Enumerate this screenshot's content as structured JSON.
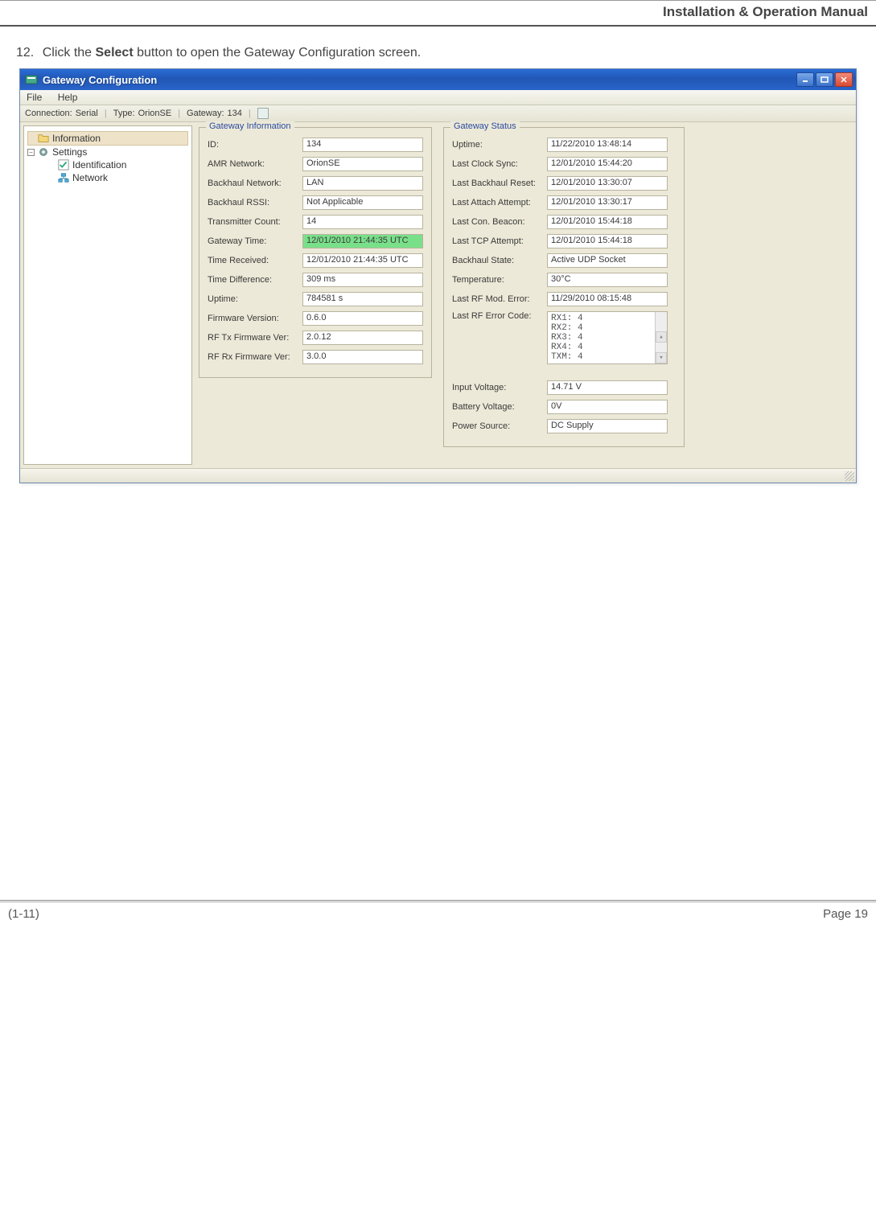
{
  "header": {
    "title": "Installation & Operation Manual"
  },
  "instruction": {
    "number": "12.",
    "prefix": "Click the ",
    "bold": "Select",
    "suffix": " button to open the Gateway Configuration screen."
  },
  "window": {
    "title": "Gateway Configuration",
    "menu": {
      "file": "File",
      "help": "Help"
    },
    "toolbar": {
      "connection_label": "Connection:",
      "connection_value": "Serial",
      "type_label": "Type:",
      "type_value": "OrionSE",
      "gateway_label": "Gateway:",
      "gateway_value": "134"
    },
    "tree": {
      "information": "Information",
      "settings": "Settings",
      "identification": "Identification",
      "network": "Network"
    }
  },
  "gateway_info": {
    "legend": "Gateway Information",
    "rows": {
      "id": {
        "label": "ID:",
        "value": "134"
      },
      "amr": {
        "label": "AMR Network:",
        "value": "OrionSE"
      },
      "backhaul_net": {
        "label": "Backhaul Network:",
        "value": "LAN"
      },
      "backhaul_rssi": {
        "label": "Backhaul RSSI:",
        "value": "Not Applicable"
      },
      "tx_count": {
        "label": "Transmitter Count:",
        "value": "14"
      },
      "gw_time": {
        "label": "Gateway Time:",
        "value": "12/01/2010 21:44:35 UTC"
      },
      "time_recv": {
        "label": "Time Received:",
        "value": "12/01/2010 21:44:35 UTC"
      },
      "time_diff": {
        "label": "Time Difference:",
        "value": "309 ms"
      },
      "uptime": {
        "label": "Uptime:",
        "value": "784581 s"
      },
      "fw": {
        "label": "Firmware Version:",
        "value": "0.6.0"
      },
      "rftx": {
        "label": "RF Tx Firmware Ver:",
        "value": "2.0.12"
      },
      "rfrx": {
        "label": "RF Rx Firmware Ver:",
        "value": "3.0.0"
      }
    }
  },
  "gateway_status": {
    "legend": "Gateway Status",
    "rows": {
      "uptime": {
        "label": "Uptime:",
        "value": "11/22/2010 13:48:14"
      },
      "last_clock": {
        "label": "Last Clock Sync:",
        "value": "12/01/2010 15:44:20"
      },
      "last_bh_reset": {
        "label": "Last Backhaul Reset:",
        "value": "12/01/2010 13:30:07"
      },
      "last_attach": {
        "label": "Last Attach Attempt:",
        "value": "12/01/2010 13:30:17"
      },
      "last_beacon": {
        "label": "Last Con. Beacon:",
        "value": "12/01/2010 15:44:18"
      },
      "last_tcp": {
        "label": "Last TCP Attempt:",
        "value": "12/01/2010 15:44:18"
      },
      "bh_state": {
        "label": "Backhaul State:",
        "value": "Active UDP Socket"
      },
      "temp": {
        "label": "Temperature:",
        "value": "30°C"
      },
      "last_rf_mod": {
        "label": "Last RF Mod. Error:",
        "value": "11/29/2010 08:15:48"
      },
      "last_rf_code": {
        "label": "Last RF Error Code:",
        "value": "RX1: 4\nRX2: 4\nRX3: 4\nRX4: 4\nTXM: 4"
      },
      "in_volt": {
        "label": "Input Voltage:",
        "value": "14.71 V"
      },
      "bat_volt": {
        "label": "Battery Voltage:",
        "value": "0V"
      },
      "pwr_src": {
        "label": "Power Source:",
        "value": "DC Supply"
      }
    }
  },
  "footer": {
    "left": "(1-11)",
    "right": "Page 19"
  }
}
